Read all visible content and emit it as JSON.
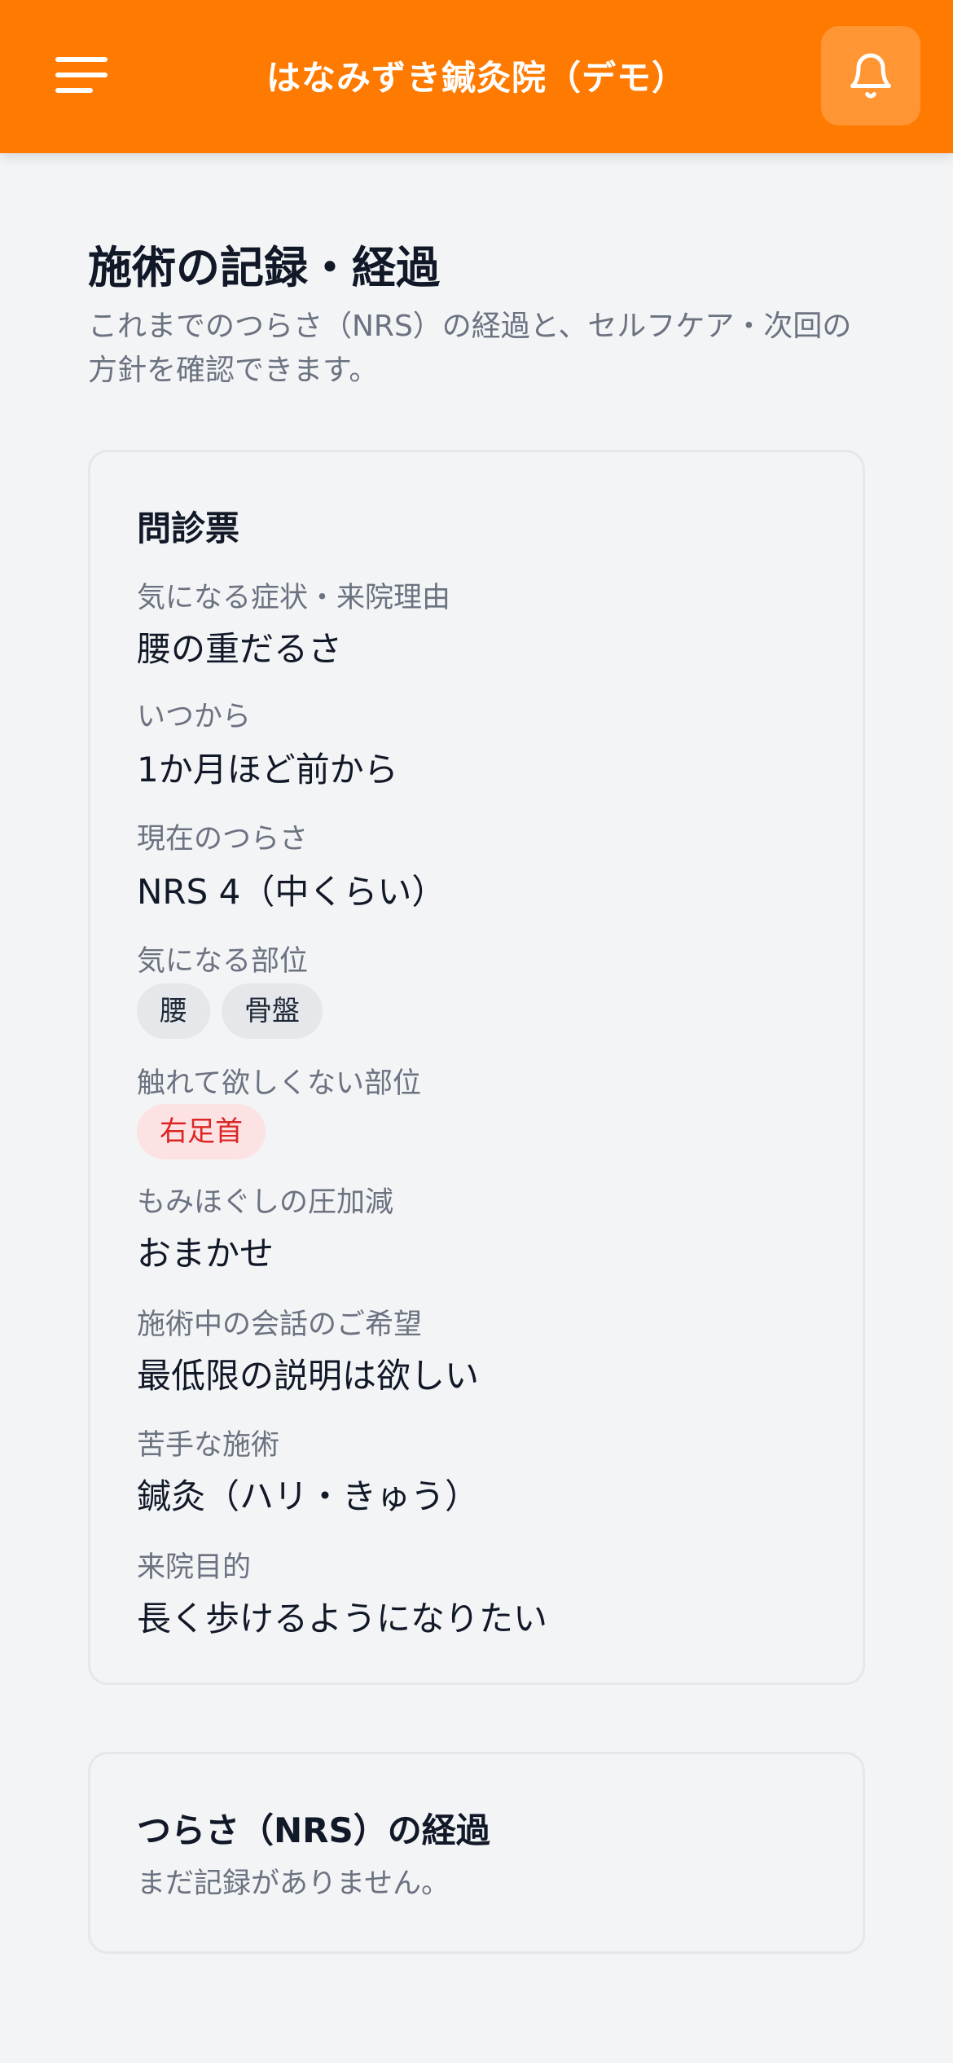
{
  "header": {
    "title": "はなみずき鍼灸院（デモ）",
    "menu_icon": "hamburger-menu-icon",
    "bell_icon": "bell-icon",
    "brand_color": "#ff7a00"
  },
  "page": {
    "title": "施術の記録・経過",
    "description": "これまでのつらさ（NRS）の経過と、セルフケア・次回の方針を確認できます。"
  },
  "questionnaire": {
    "heading": "問診票",
    "symptom": {
      "label": "気になる症状・来院理由",
      "value": "腰の重だるさ"
    },
    "since": {
      "label": "いつから",
      "value": "1か月ほど前から"
    },
    "current_pain": {
      "label": "現在のつらさ",
      "value": "NRS 4（中くらい）"
    },
    "areas": {
      "label": "気になる部位",
      "chips": [
        "腰",
        "骨盤"
      ]
    },
    "no_touch": {
      "label": "触れて欲しくない部位",
      "chips": [
        "右足首"
      ]
    },
    "pressure": {
      "label": "もみほぐしの圧加減",
      "value": "おまかせ"
    },
    "conversation": {
      "label": "施術中の会話のご希望",
      "value": "最低限の説明は欲しい"
    },
    "disliked": {
      "label": "苦手な施術",
      "value": "鍼灸（ハリ・きゅう）"
    },
    "goal": {
      "label": "来院目的",
      "value": "長く歩けるようになりたい"
    }
  },
  "nrs_history": {
    "heading": "つらさ（NRS）の経過",
    "empty_message": "まだ記録がありません。"
  }
}
